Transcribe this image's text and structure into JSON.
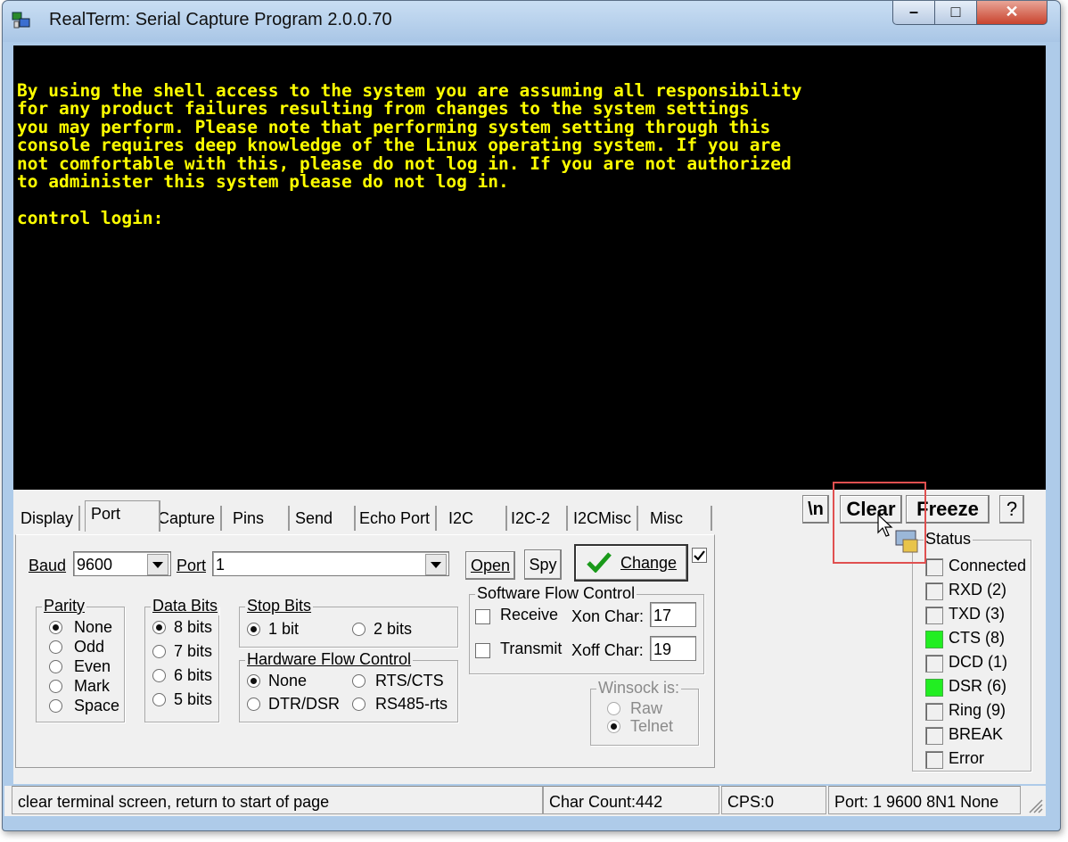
{
  "window": {
    "title": "RealTerm: Serial Capture Program 2.0.0.70"
  },
  "terminal": {
    "lines": [
      "By using the shell access to the system you are assuming all responsibility",
      "for any product failures resulting from changes to the system settings",
      "you may perform. Please note that performing system setting through this",
      "console requires deep knowledge of the Linux operating system. If you are",
      "not comfortable with this, please do not log in. If you are not authorized",
      "to administer this system please do not log in.",
      "",
      "control login:"
    ],
    "text_color": "#ffff00",
    "background": "#000000"
  },
  "tabs": [
    "Display",
    "Port",
    "Capture",
    "Pins",
    "Send",
    "Echo Port",
    "I2C",
    "I2C-2",
    "I2CMisc",
    "Misc"
  ],
  "active_tab": "Port",
  "toolbar": {
    "newline": "\\n",
    "clear": "Clear",
    "freeze": "Freeze",
    "help": "?"
  },
  "port": {
    "baud_label": "Baud",
    "baud_value": "9600",
    "port_label": "Port",
    "port_value": "1",
    "open_label": "Open",
    "spy_label": "Spy",
    "change_label": "Change",
    "change_checked": true,
    "parity": {
      "title": "Parity",
      "options": [
        "None",
        "Odd",
        "Even",
        "Mark",
        "Space"
      ],
      "selected": "None"
    },
    "data_bits": {
      "title": "Data Bits",
      "options": [
        "8 bits",
        "7 bits",
        "6 bits",
        "5 bits"
      ],
      "selected": "8 bits"
    },
    "stop_bits": {
      "title": "Stop Bits",
      "options": [
        "1 bit",
        "2 bits"
      ],
      "selected": "1 bit"
    },
    "hw_flow": {
      "title": "Hardware Flow Control",
      "options": [
        "None",
        "RTS/CTS",
        "DTR/DSR",
        "RS485-rts"
      ],
      "selected": "None"
    },
    "sw_flow": {
      "title": "Software Flow Control",
      "receive_label": "Receive",
      "transmit_label": "Transmit",
      "receive_checked": false,
      "transmit_checked": false,
      "xon_label": "Xon Char:",
      "xon_value": "17",
      "xoff_label": "Xoff Char:",
      "xoff_value": "19"
    },
    "winsock": {
      "title": "Winsock is:",
      "options": [
        "Raw",
        "Telnet"
      ],
      "selected": "Telnet"
    }
  },
  "status": {
    "title": "Status",
    "items": [
      {
        "label": "Connected",
        "on": false
      },
      {
        "label": "RXD (2)",
        "on": false
      },
      {
        "label": "TXD (3)",
        "on": false
      },
      {
        "label": "CTS (8)",
        "on": true
      },
      {
        "label": "DCD (1)",
        "on": false
      },
      {
        "label": "DSR (6)",
        "on": true
      },
      {
        "label": "Ring (9)",
        "on": false
      },
      {
        "label": "BREAK",
        "on": false
      },
      {
        "label": "Error",
        "on": false
      }
    ],
    "on_color": "#22ee22"
  },
  "statusbar": {
    "hint": "clear terminal screen, return to start of page",
    "char_count": "Char Count:442",
    "cps": "CPS:0",
    "port_info": "Port: 1 9600 8N1 None"
  }
}
